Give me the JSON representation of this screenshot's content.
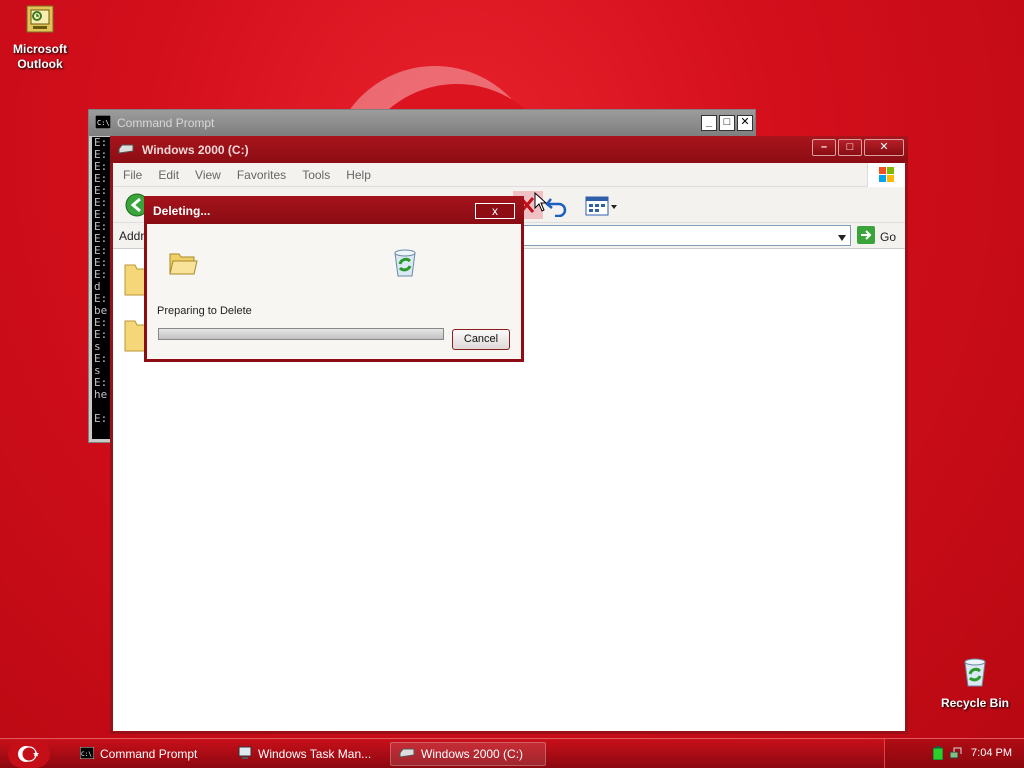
{
  "desktop": {
    "icons": [
      {
        "label": "Microsoft Outlook",
        "icon": "outlook-icon"
      },
      {
        "label": "Recycle Bin",
        "icon": "recycle-bin-icon"
      }
    ]
  },
  "cmd_window": {
    "title": "Command Prompt",
    "lines": [
      "E:",
      "E:",
      "E:",
      "E:",
      "E:",
      "E:",
      "E:",
      "E:",
      "E:",
      "E:",
      "E:",
      "E:",
      "d",
      "E:",
      "be",
      "E:",
      "E:",
      "s",
      "E:",
      "s",
      "E:",
      "he",
      "",
      "E:"
    ]
  },
  "explorer": {
    "title": "Windows 2000 (C:)",
    "menu": [
      "File",
      "Edit",
      "View",
      "Favorites",
      "Tools",
      "Help"
    ],
    "address_label": "Addr",
    "go_label": "Go"
  },
  "dialog": {
    "title": "Deleting...",
    "status": "Preparing to Delete",
    "cancel_label": "Cancel",
    "close_label": "x",
    "progress": 0.0
  },
  "taskbar": {
    "tasks": [
      {
        "label": "Command Prompt",
        "icon": "cmd-icon"
      },
      {
        "label": "Windows Task Man...",
        "icon": "task-manager-icon"
      },
      {
        "label": "Windows 2000 (C:)",
        "icon": "drive-icon"
      }
    ],
    "clock": "7:04 PM"
  }
}
